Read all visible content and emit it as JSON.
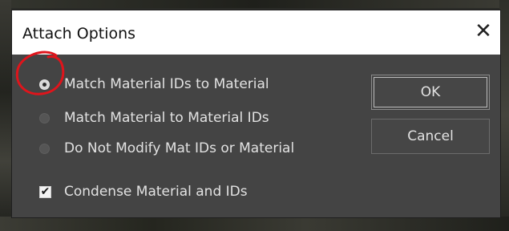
{
  "dialog": {
    "title": "Attach Options",
    "close_glyph": "✕",
    "close_icon": "close-icon"
  },
  "options": [
    {
      "label": "Match Material IDs to Material",
      "selected": true
    },
    {
      "label": "Match Material to Material IDs",
      "selected": false
    },
    {
      "label": "Do Not Modify Mat IDs or Material",
      "selected": false
    }
  ],
  "condense": {
    "label": "Condense Material and IDs",
    "checked": true,
    "check_glyph": "✔"
  },
  "buttons": {
    "ok_label": "OK",
    "cancel_label": "Cancel"
  },
  "colors": {
    "annotation": "#e0141b",
    "dialog_bg": "#444444",
    "titlebar_bg": "#ffffff"
  }
}
